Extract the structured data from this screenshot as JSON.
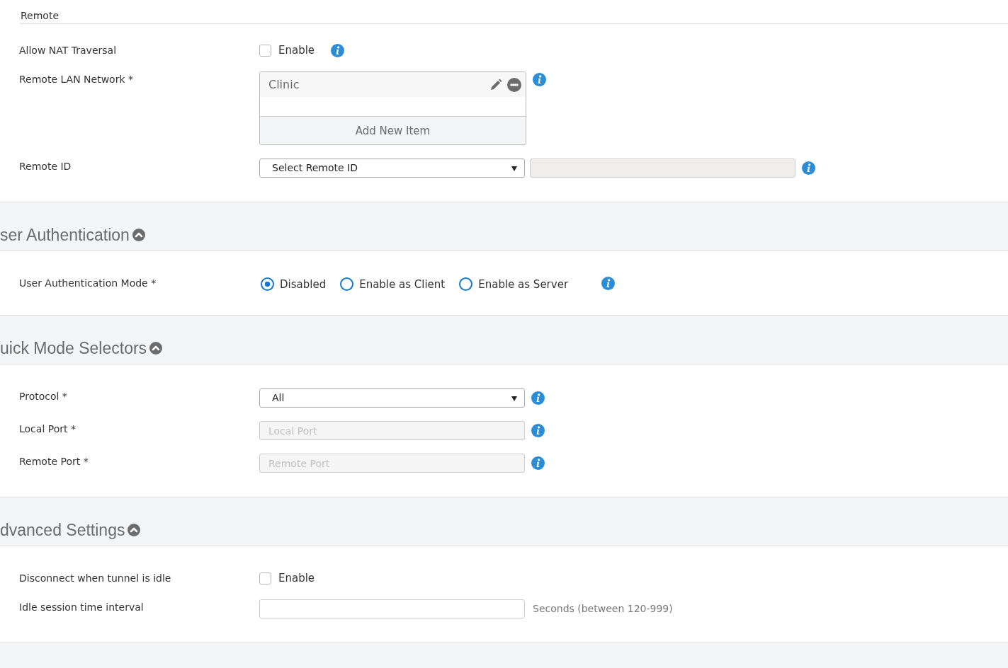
{
  "sections": [
    {
      "kind": "plain",
      "title": "Remote",
      "rows": [
        {
          "label": "Allow NAT Traversal",
          "kind": "checkbox",
          "checked": false,
          "text": "Enable",
          "info": true
        },
        {
          "label": "Remote LAN Network *",
          "kind": "list",
          "items": [
            {
              "text": "Clinic"
            }
          ],
          "add_label": "Add New Item",
          "info": true
        },
        {
          "label": "Remote ID",
          "kind": "select_pair",
          "value": "Select Remote ID",
          "second_disabled": true,
          "info": true
        }
      ]
    },
    {
      "kind": "collapsible",
      "title": "ser Authentication",
      "expanded": true,
      "rows": [
        {
          "label": "User Authentication Mode *",
          "kind": "radio",
          "options": [
            {
              "text": "Disabled",
              "selected": true
            },
            {
              "text": "Enable as Client",
              "selected": false
            },
            {
              "text": "Enable as Server",
              "selected": false
            }
          ],
          "info": true
        }
      ]
    },
    {
      "kind": "collapsible",
      "title": "uick Mode Selectors",
      "expanded": true,
      "rows": [
        {
          "label": "Protocol *",
          "kind": "select",
          "value": "All",
          "info": true
        },
        {
          "label": "Local Port *",
          "kind": "text",
          "placeholder": "Local Port",
          "disabled": true,
          "info": true
        },
        {
          "label": "Remote Port *",
          "kind": "text",
          "placeholder": "Remote Port",
          "disabled": true,
          "info": true
        }
      ]
    },
    {
      "kind": "collapsible",
      "title": "dvanced Settings",
      "expanded": true,
      "rows": [
        {
          "label": "Disconnect when tunnel is idle",
          "kind": "checkbox",
          "checked": false,
          "text": "Enable",
          "info": false
        },
        {
          "label": "Idle session time interval",
          "kind": "text",
          "disabled": false,
          "hint": "Seconds (between 120-999)",
          "info": false
        }
      ]
    }
  ]
}
